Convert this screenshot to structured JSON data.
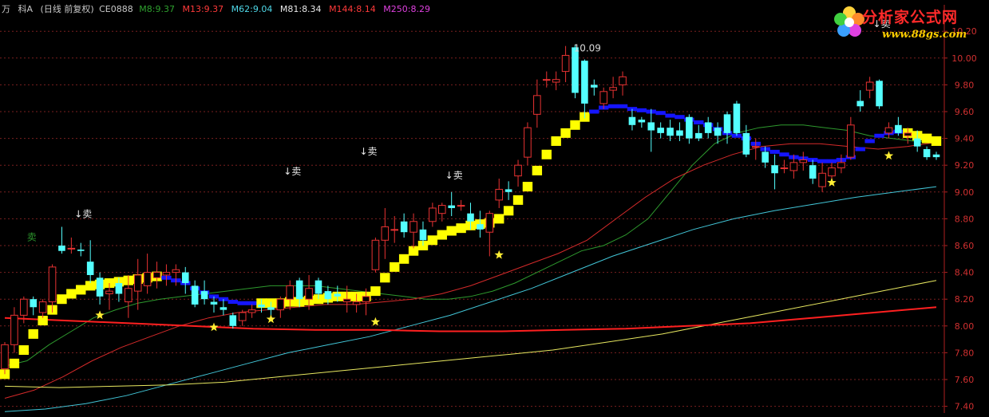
{
  "header": {
    "prefix": "万",
    "stock_name": "科A",
    "period": "(日线 前复权)",
    "indicator": "CE0888",
    "ma": [
      {
        "label": "M8:",
        "value": "9.37",
        "color": "#2ea02e"
      },
      {
        "label": "M13:",
        "value": "9.37",
        "color": "#ff3a3a"
      },
      {
        "label": "M62:",
        "value": "9.04",
        "color": "#4fd8e8"
      },
      {
        "label": "M81:",
        "value": "8.34",
        "color": "#e8e8e8"
      },
      {
        "label": "M144:",
        "value": "8.14",
        "color": "#ff3a3a"
      },
      {
        "label": "M250:",
        "value": "8.29",
        "color": "#e040e0"
      }
    ]
  },
  "logo": {
    "title": "分析家公式网",
    "url": "www.88gs.com"
  },
  "chart_data": {
    "type": "candlestick",
    "y_range": [
      7.35,
      10.35
    ],
    "y_ticks": [
      "7.40",
      "7.60",
      "7.80",
      "8.00",
      "8.20",
      "8.40",
      "8.60",
      "8.80",
      "9.00",
      "9.20",
      "9.40",
      "9.60",
      "9.80",
      "10.00",
      "10.20"
    ],
    "x_count": 80,
    "colors": {
      "up": "#e83232",
      "down": "#54ffff",
      "grid": "#7a1f1f",
      "axis": "#b02020",
      "tick_text": "#d03030"
    },
    "candles": [
      [
        7.68,
        7.88,
        7.64,
        7.86
      ],
      [
        7.86,
        8.14,
        7.8,
        8.08
      ],
      [
        8.08,
        8.22,
        8.02,
        8.2
      ],
      [
        8.2,
        8.22,
        8.08,
        8.14
      ],
      [
        8.1,
        8.2,
        8.06,
        8.18
      ],
      [
        8.18,
        8.46,
        8.1,
        8.44
      ],
      [
        8.6,
        8.74,
        8.54,
        8.56
      ],
      [
        8.58,
        8.66,
        8.54,
        8.58
      ],
      [
        8.57,
        8.62,
        8.52,
        8.56
      ],
      [
        8.48,
        8.64,
        8.32,
        8.38
      ],
      [
        8.36,
        8.4,
        8.16,
        8.22
      ],
      [
        8.24,
        8.32,
        8.12,
        8.26
      ],
      [
        8.32,
        8.36,
        8.18,
        8.24
      ],
      [
        8.18,
        8.38,
        8.06,
        8.28
      ],
      [
        8.26,
        8.5,
        8.12,
        8.38
      ],
      [
        8.3,
        8.54,
        8.24,
        8.4
      ],
      [
        8.36,
        8.48,
        8.28,
        8.4
      ],
      [
        8.38,
        8.46,
        8.3,
        8.4
      ],
      [
        8.4,
        8.46,
        8.3,
        8.42
      ],
      [
        8.4,
        8.44,
        8.24,
        8.32
      ],
      [
        8.3,
        8.34,
        8.14,
        8.16
      ],
      [
        8.26,
        8.34,
        8.16,
        8.2
      ],
      [
        8.18,
        8.22,
        8.1,
        8.16
      ],
      [
        8.14,
        8.2,
        8.08,
        8.12
      ],
      [
        8.08,
        8.1,
        7.98,
        8.0
      ],
      [
        8.04,
        8.12,
        8.0,
        8.1
      ],
      [
        8.1,
        8.16,
        8.06,
        8.12
      ],
      [
        8.16,
        8.2,
        8.1,
        8.14
      ],
      [
        8.14,
        8.18,
        8.04,
        8.12
      ],
      [
        8.12,
        8.22,
        8.06,
        8.2
      ],
      [
        8.2,
        8.34,
        8.12,
        8.3
      ],
      [
        8.34,
        8.36,
        8.14,
        8.2
      ],
      [
        8.2,
        8.38,
        8.12,
        8.28
      ],
      [
        8.34,
        8.36,
        8.2,
        8.24
      ],
      [
        8.26,
        8.3,
        8.16,
        8.2
      ],
      [
        8.24,
        8.3,
        8.18,
        8.22
      ],
      [
        8.18,
        8.3,
        8.1,
        8.2
      ],
      [
        8.16,
        8.24,
        8.1,
        8.18
      ],
      [
        8.18,
        8.28,
        8.08,
        8.22
      ],
      [
        8.42,
        8.66,
        8.4,
        8.64
      ],
      [
        8.64,
        8.88,
        8.5,
        8.74
      ],
      [
        8.72,
        8.82,
        8.62,
        8.72
      ],
      [
        8.78,
        8.84,
        8.66,
        8.7
      ],
      [
        8.7,
        8.84,
        8.58,
        8.78
      ],
      [
        8.72,
        8.78,
        8.6,
        8.64
      ],
      [
        8.78,
        8.92,
        8.74,
        8.88
      ],
      [
        8.84,
        8.92,
        8.78,
        8.9
      ],
      [
        8.9,
        9.0,
        8.82,
        8.88
      ],
      [
        8.9,
        8.94,
        8.86,
        8.9
      ],
      [
        8.84,
        8.92,
        8.72,
        8.78
      ],
      [
        8.76,
        8.86,
        8.66,
        8.72
      ],
      [
        8.7,
        8.86,
        8.52,
        8.84
      ],
      [
        8.94,
        9.1,
        8.88,
        9.02
      ],
      [
        9.02,
        9.08,
        8.94,
        9.0
      ],
      [
        9.12,
        9.24,
        9.04,
        9.2
      ],
      [
        9.26,
        9.52,
        9.2,
        9.48
      ],
      [
        9.58,
        9.84,
        9.48,
        9.72
      ],
      [
        9.84,
        9.9,
        9.78,
        9.84
      ],
      [
        9.82,
        9.9,
        9.76,
        9.84
      ],
      [
        9.9,
        10.09,
        9.82,
        10.02
      ],
      [
        10.08,
        10.1,
        9.7,
        9.74
      ],
      [
        9.98,
        9.99,
        9.55,
        9.66
      ],
      [
        9.8,
        9.84,
        9.72,
        9.78
      ],
      [
        9.66,
        9.78,
        9.62,
        9.75
      ],
      [
        9.76,
        9.86,
        9.7,
        9.78
      ],
      [
        9.8,
        9.9,
        9.72,
        9.86
      ],
      [
        9.56,
        9.62,
        9.46,
        9.5
      ],
      [
        9.54,
        9.56,
        9.48,
        9.52
      ],
      [
        9.52,
        9.62,
        9.3,
        9.46
      ],
      [
        9.48,
        9.52,
        9.4,
        9.44
      ],
      [
        9.48,
        9.54,
        9.38,
        9.42
      ],
      [
        9.46,
        9.52,
        9.38,
        9.42
      ],
      [
        9.56,
        9.58,
        9.36,
        9.4
      ],
      [
        9.44,
        9.5,
        9.38,
        9.4
      ],
      [
        9.52,
        9.56,
        9.4,
        9.44
      ],
      [
        9.48,
        9.52,
        9.36,
        9.42
      ],
      [
        9.58,
        9.6,
        9.36,
        9.44
      ],
      [
        9.66,
        9.68,
        9.42,
        9.44
      ],
      [
        9.44,
        9.5,
        9.26,
        9.28
      ],
      [
        9.34,
        9.4,
        9.24,
        9.34
      ]
    ],
    "candles_tail": [
      [
        9.3,
        9.34,
        9.18,
        9.22
      ],
      [
        9.2,
        9.28,
        9.02,
        9.14
      ],
      [
        9.18,
        9.24,
        9.14,
        9.18
      ],
      [
        9.16,
        9.28,
        9.1,
        9.22
      ],
      [
        9.22,
        9.3,
        9.16,
        9.24
      ],
      [
        9.2,
        9.24,
        9.06,
        9.1
      ],
      [
        9.04,
        9.22,
        9.0,
        9.14
      ],
      [
        9.12,
        9.22,
        9.06,
        9.18
      ],
      [
        9.18,
        9.28,
        9.14,
        9.22
      ],
      [
        9.26,
        9.56,
        9.24,
        9.5
      ],
      [
        9.68,
        9.76,
        9.6,
        9.64
      ],
      [
        9.76,
        9.86,
        9.7,
        9.82
      ],
      [
        9.83,
        9.84,
        9.62,
        9.64
      ],
      [
        9.44,
        9.52,
        9.4,
        9.48
      ],
      [
        9.5,
        9.56,
        9.42,
        9.44
      ],
      [
        9.42,
        9.48,
        9.36,
        9.44
      ],
      [
        9.4,
        9.46,
        9.3,
        9.34
      ],
      [
        9.32,
        9.34,
        9.24,
        9.26
      ],
      [
        9.28,
        9.3,
        9.24,
        9.26
      ]
    ],
    "ma_colors": [
      "#2e9a2e",
      "#d42a2a",
      "#42c6d8",
      "#e8e860",
      "#ff2020"
    ],
    "ma_lines": [
      [
        7.7,
        7.74,
        7.86,
        7.96,
        8.06,
        8.12,
        8.17,
        8.2,
        8.22,
        8.24,
        8.26,
        8.28,
        8.3,
        8.3,
        8.3,
        8.28,
        8.26,
        8.24,
        8.22,
        8.2,
        8.2,
        8.22,
        8.26,
        8.32,
        8.4,
        8.48,
        8.56,
        8.6,
        8.68,
        8.8,
        9.0,
        9.2,
        9.36,
        9.44,
        9.48,
        9.5,
        9.5,
        9.48,
        9.46,
        9.42,
        9.4,
        9.38,
        9.37
      ],
      [
        7.46,
        7.52,
        7.62,
        7.74,
        7.84,
        7.92,
        8.0,
        8.06,
        8.1,
        8.12,
        8.14,
        8.16,
        8.16,
        8.18,
        8.2,
        8.24,
        8.3,
        8.38,
        8.46,
        8.54,
        8.64,
        8.8,
        8.96,
        9.1,
        9.2,
        9.28,
        9.34,
        9.36,
        9.36,
        9.34,
        9.32,
        9.34,
        9.37
      ],
      [
        7.36,
        7.38,
        7.42,
        7.48,
        7.56,
        7.64,
        7.72,
        7.8,
        7.86,
        7.92,
        8.0,
        8.08,
        8.18,
        8.28,
        8.4,
        8.52,
        8.62,
        8.72,
        8.8,
        8.86,
        8.91,
        8.96,
        9.0,
        9.04
      ],
      [
        7.55,
        7.54,
        7.55,
        7.56,
        7.58,
        7.62,
        7.66,
        7.7,
        7.74,
        7.78,
        7.82,
        7.88,
        7.94,
        8.02,
        8.1,
        8.18,
        8.26,
        8.34
      ],
      [
        8.06,
        8.04,
        8.02,
        8.0,
        7.98,
        7.97,
        7.97,
        7.96,
        7.96,
        7.97,
        7.98,
        8.0,
        8.02,
        8.06,
        8.1,
        8.14
      ]
    ],
    "band": {
      "colors": {
        "yellow": "#ffff00",
        "blue": "#1515ff"
      },
      "values": [
        7.64,
        7.72,
        7.82,
        7.94,
        8.04,
        8.12,
        8.2,
        8.24,
        8.27,
        8.3,
        8.31,
        8.32,
        8.33,
        8.34,
        8.35,
        8.36,
        8.37,
        8.36,
        8.34,
        8.32,
        8.28,
        8.25,
        8.22,
        8.2,
        8.18,
        8.17,
        8.17,
        8.17,
        8.17,
        8.17,
        8.18,
        8.18,
        8.19,
        8.2,
        8.21,
        8.22,
        8.22,
        8.22,
        8.22,
        8.26,
        8.36,
        8.44,
        8.5,
        8.56,
        8.6,
        8.64,
        8.68,
        8.71,
        8.73,
        8.75,
        8.76,
        8.77,
        8.8,
        8.86,
        8.94,
        9.04,
        9.16,
        9.28,
        9.38,
        9.44,
        9.5,
        9.56,
        9.6,
        9.63,
        9.64,
        9.64,
        9.62,
        9.61,
        9.6,
        9.59,
        9.57,
        9.56,
        9.54,
        9.52,
        9.5,
        9.47,
        9.44,
        9.42,
        9.4,
        9.36
      ],
      "values_tail": [
        9.32,
        9.3,
        9.28,
        9.26,
        9.25,
        9.24,
        9.23,
        9.23,
        9.24,
        9.26,
        9.32,
        9.38,
        9.42,
        9.44,
        9.45,
        9.44,
        9.42,
        9.4,
        9.38
      ],
      "blue_ranges": [
        [
          17,
          27
        ],
        [
          62,
          80
        ],
        [
          80,
          95
        ]
      ]
    },
    "stars": [
      {
        "i": 10,
        "v": 8.08
      },
      {
        "i": 22,
        "v": 7.99
      },
      {
        "i": 28,
        "v": 8.05
      },
      {
        "i": 39,
        "v": 8.03
      },
      {
        "i": 52,
        "v": 8.53
      },
      {
        "i": 87,
        "v": 9.07
      },
      {
        "i": 93,
        "v": 9.27
      }
    ],
    "annotations": [
      {
        "text": "卖",
        "i": 3,
        "v": 8.64,
        "color": "#2e9a2e"
      },
      {
        "text": "↓卖",
        "i": 8,
        "v": 8.81,
        "color": "#e8e8e8"
      },
      {
        "text": "↓卖",
        "i": 30,
        "v": 9.13,
        "color": "#e8e8e8"
      },
      {
        "text": "↓卖",
        "i": 38,
        "v": 9.28,
        "color": "#e8e8e8"
      },
      {
        "text": "↓卖",
        "i": 47,
        "v": 9.1,
        "color": "#e8e8e8"
      },
      {
        "text": "↓卖",
        "i": 58,
        "v": 10.5,
        "color": "#e8e8e8"
      },
      {
        "text": "↓卖",
        "i": 92,
        "v": 10.23,
        "color": "#e8e8e8"
      },
      {
        "text": "10.09",
        "i": 59,
        "v": 10.05,
        "color": "#d8d8d8"
      }
    ]
  }
}
